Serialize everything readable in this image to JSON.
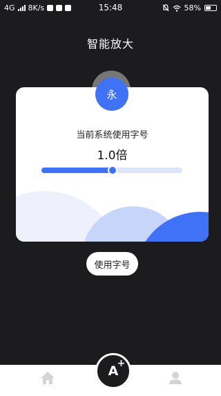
{
  "status_bar": {
    "network": "4G",
    "speed": "8K/s",
    "time": "15:48",
    "battery": "58%",
    "battery_level": 0.58
  },
  "header": {
    "title": "智能放大"
  },
  "card": {
    "sample_char": "永",
    "label": "当前系统使用字号",
    "value": "1.0倍",
    "slider_level": 0.5
  },
  "actions": {
    "use_button": "使用字号"
  },
  "bottom_nav": {
    "center_label": "A",
    "center_sup": "+",
    "items": [
      "home-icon",
      "user-icon"
    ]
  },
  "colors": {
    "accent": "#3f72f6",
    "background": "#1c1c1e",
    "card": "#ffffff"
  }
}
